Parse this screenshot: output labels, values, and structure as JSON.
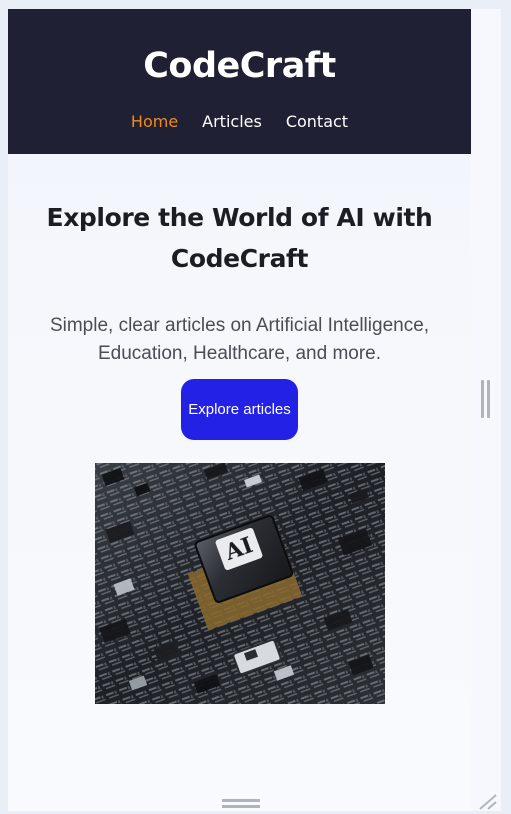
{
  "site": {
    "brand": "CodeCraft",
    "nav": [
      {
        "label": "Home",
        "active": true
      },
      {
        "label": "Articles",
        "active": false
      },
      {
        "label": "Contact",
        "active": false
      }
    ]
  },
  "hero": {
    "title": "Explore the World of AI with CodeCraft",
    "subtitle": "Simple, clear articles on Artificial Intelligence, Education, Healthcare, and more.",
    "cta_label": "Explore articles",
    "image_chip_label": "AI"
  },
  "colors": {
    "header_bg": "#1f2033",
    "nav_active": "#f28a1e",
    "cta_bg": "#2321e6",
    "title_text": "#1c1c24"
  },
  "icons": {
    "vertical_divider": "grip-vertical-icon",
    "horizontal_divider": "grip-horizontal-icon",
    "corner": "resize-corner-icon"
  }
}
